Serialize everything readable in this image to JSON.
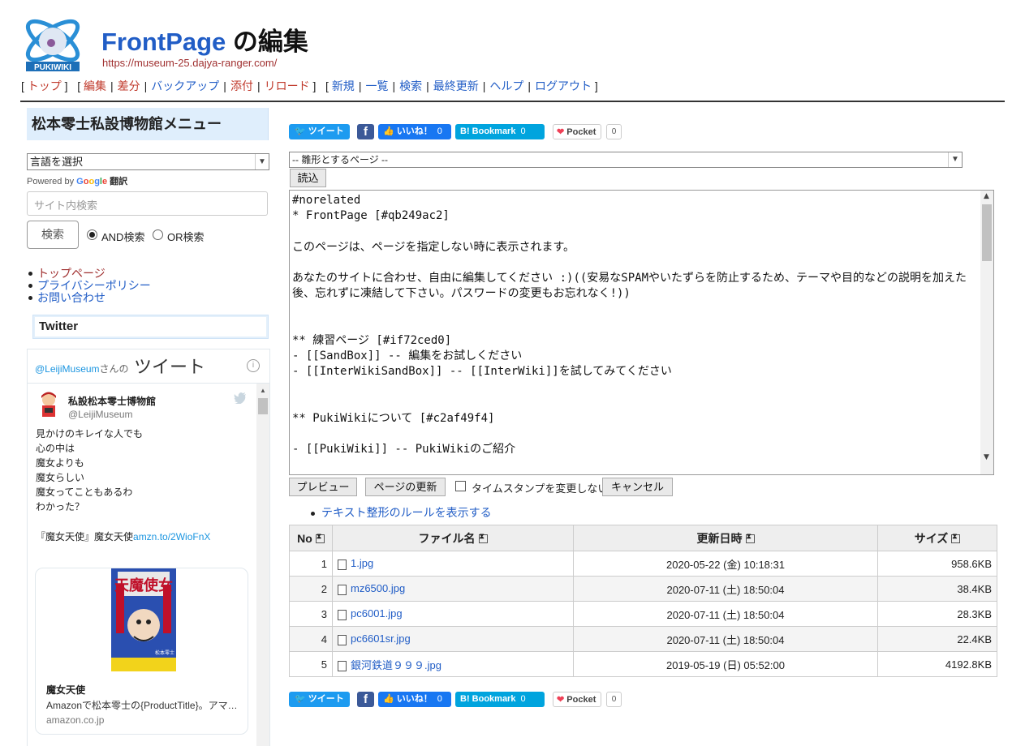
{
  "header": {
    "logo_text": "PUKIWIKI",
    "page_name": "FrontPage",
    "title_suffix": " の編集",
    "url": "https://museum-25.dajya-ranger.com/"
  },
  "nav": {
    "top": "トップ",
    "edit": "編集",
    "diff": "差分",
    "backup": "バックアップ",
    "attach": "添付",
    "reload": "リロード",
    "new": "新規",
    "list": "一覧",
    "search": "検索",
    "recent": "最終更新",
    "help": "ヘルプ",
    "logout": "ログアウト"
  },
  "sidebar": {
    "menu_title": "松本零士私設博物館メニュー",
    "lang_select": "言語を選択",
    "powered_by": "Powered by",
    "google": [
      "G",
      "o",
      "o",
      "g",
      "l",
      "e"
    ],
    "translate": "翻訳",
    "search_placeholder": "サイト内検索",
    "search_button": "検索",
    "and_search": "AND検索",
    "or_search": "OR検索",
    "links": [
      "トップページ",
      "プライバシーポリシー",
      "お問い合わせ"
    ],
    "twitter_title": "Twitter"
  },
  "twitter": {
    "handle": "@LeijiMuseum",
    "handle_suffix": "さんの",
    "tweets_word": "ツイート",
    "info": "i",
    "author_name": "私設松本零士博物館",
    "author_id": "@LeijiMuseum",
    "tweet_text": "見かけのキレイな人でも\n心の中は\n魔女よりも\n魔女らしい\n魔女ってこともあるわ\nわかった？",
    "tweet_line_prefix": "『魔女天使』魔女天使",
    "tweet_link": "amzn.to/2WioFnX",
    "cover_title": "天魔使女",
    "cover_author": "松本零士",
    "card_title": "魔女天使",
    "card_desc": "Amazonで松本零士の{ProductTitle}。アマ…",
    "card_domain": "amazon.co.jp"
  },
  "share": {
    "tweet": "ツイート",
    "facebook": "f",
    "like": "いいね！",
    "like_count": "0",
    "hatena": "B! Bookmark",
    "hatena_count": "0",
    "pocket": "Pocket",
    "pocket_count": "0"
  },
  "editor": {
    "template_select": "-- 雛形とするページ --",
    "load_button": "読込",
    "text": "#norelated\n* FrontPage [#qb249ac2]\n\nこのページは、ページを指定しない時に表示されます。\n\nあなたのサイトに合わせ、自由に編集してください :)((安易なSPAMやいたずらを防止するため、テーマや目的などの説明を加えた後、忘れずに凍結して下さい。パスワードの変更もお忘れなく!))\n\n\n** 練習ページ [#if72ced0]\n- [[SandBox]] -- 編集をお試しください\n- [[InterWikiSandBox]] -- [[InterWiki]]を試してみてください\n\n\n** PukiWikiについて [#c2af49f4]\n\n- [[PukiWiki]] -- PukiWikiのご紹介",
    "preview_button": "プレビュー",
    "update_button": "ページの更新",
    "no_timestamp": "タイムスタンプを変更しない",
    "cancel_button": "キャンセル",
    "rules_link": "テキスト整形のルールを表示する"
  },
  "files": {
    "headers": [
      "No",
      "ファイル名",
      "更新日時",
      "サイズ"
    ],
    "rows": [
      {
        "no": "1",
        "name": "1.jpg",
        "date": "2020-05-22 (金) 10:18:31",
        "size": "958.6KB"
      },
      {
        "no": "2",
        "name": "mz6500.jpg",
        "date": "2020-07-11 (土) 18:50:04",
        "size": "38.4KB"
      },
      {
        "no": "3",
        "name": "pc6001.jpg",
        "date": "2020-07-11 (土) 18:50:04",
        "size": "28.3KB"
      },
      {
        "no": "4",
        "name": "pc6601sr.jpg",
        "date": "2020-07-11 (土) 18:50:04",
        "size": "22.4KB"
      },
      {
        "no": "5",
        "name": "銀河鉄道９９９.jpg",
        "date": "2019-05-19 (日) 05:52:00",
        "size": "4192.8KB"
      }
    ]
  }
}
